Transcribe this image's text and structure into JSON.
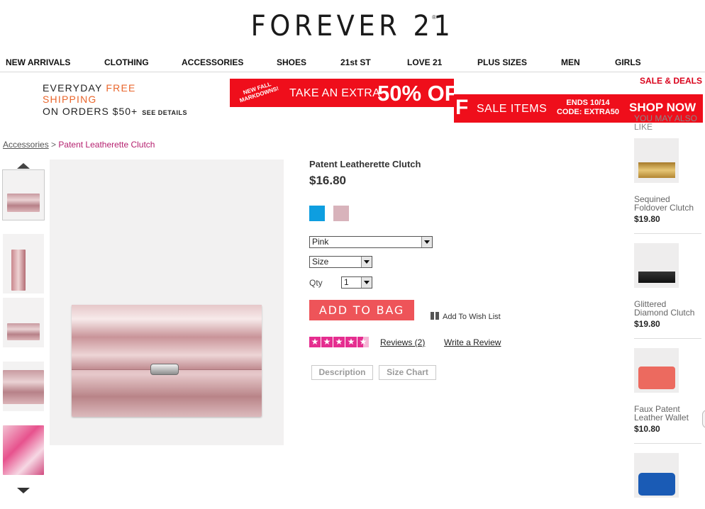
{
  "brand": {
    "logo": "FOREVER 21",
    "reg": "®"
  },
  "nav": {
    "items": [
      "NEW ARRIVALS",
      "CLOTHING",
      "ACCESSORIES",
      "SHOES",
      "21st ST",
      "LOVE 21",
      "PLUS SIZES",
      "MEN",
      "GIRLS"
    ],
    "sale": "SALE & DEALS"
  },
  "promo": {
    "shipping_prefix": "EVERYDAY",
    "shipping_highlight": "FREE SHIPPING",
    "shipping_line2": "ON ORDERS $50+",
    "see_details": "SEE DETAILS",
    "markdowns": "NEW FALL MARKDOWNS!",
    "take_extra": "TAKE AN EXTRA",
    "percent": "50% OF",
    "off_tail": "F",
    "sale_items": "SALE ITEMS",
    "ends": "ENDS 10/14",
    "code": "CODE: EXTRA50",
    "shop_now": "SHOP NOW"
  },
  "breadcrumb": {
    "parent": "Accessories",
    "sep": ">",
    "current": "Patent Leatherette Clutch"
  },
  "product": {
    "title": "Patent Leatherette Clutch",
    "price": "$16.80",
    "swatches": [
      {
        "name": "blue",
        "color": "#0e9ee0"
      },
      {
        "name": "pink",
        "color": "#d8b3bb"
      }
    ],
    "color_select": "Pink",
    "size_select": "Size",
    "qty_label": "Qty",
    "qty_value": "1",
    "add_to_bag": "ADD TO BAG",
    "wish_list": "Add To Wish List",
    "rating": 4.5,
    "rating_max": 5,
    "reviews": "Reviews (2)",
    "write_review": "Write a Review",
    "tabs": [
      "Description",
      "Size Chart"
    ]
  },
  "sidebar": {
    "heading": "YOU MAY ALSO LIKE",
    "items": [
      {
        "name": "Sequined Foldover Clutch",
        "price": "$19.80",
        "color": "#c9a04a"
      },
      {
        "name": "Glittered Diamond Clutch",
        "price": "$19.80",
        "color": "#1d1d1d"
      },
      {
        "name": "Faux Patent Leather Wallet",
        "price": "$10.80",
        "color": "#ec6a5f"
      },
      {
        "name": "",
        "price": "",
        "color": "#1a5bb5"
      }
    ]
  }
}
